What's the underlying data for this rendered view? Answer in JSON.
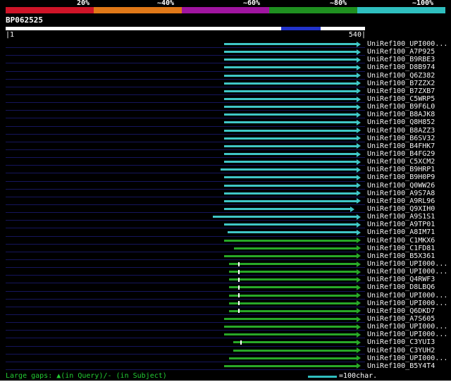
{
  "query": {
    "name": "BP062525",
    "bar_color": "#ffffff",
    "highlight": {
      "from": 414,
      "to": 473,
      "color": "#2233cc"
    }
  },
  "ruler": {
    "left": "|1",
    "right": "540|"
  },
  "footer": {
    "gaps_note": "Large gaps: ▲(in Query)/- (in Subject)",
    "gaps_color": "#22cc33",
    "scale_legend": "=100char.",
    "scale_line_color": "#2fbfbf",
    "scale_text_color": "#ffffff"
  },
  "chart_data": {
    "type": "bar",
    "orientation": "horizontal",
    "title": "BP062525 BLAST hit graphical overview",
    "x_axis": {
      "min": 1,
      "max": 540,
      "tick_labels": [
        "1",
        "540"
      ]
    },
    "grid": "row-separator-lines",
    "legend_position": "top",
    "legend": [
      {
        "label": "20%",
        "color": "#cf1428"
      },
      {
        "label": "~40%",
        "color": "#e07818"
      },
      {
        "label": "~60%",
        "color": "#a015a0"
      },
      {
        "label": "~80%",
        "color": "#1f9020"
      },
      {
        "label": "~100%",
        "color": "#2fbfbf"
      }
    ],
    "identity_colors": {
      "~100%": "#3fc6c6",
      "~80%": "#28a828"
    },
    "hits": [
      {
        "label": "UniRef100_UPI000...",
        "start": 329,
        "end": 534,
        "identity": "~100%"
      },
      {
        "label": "UniRef100_A7P925",
        "start": 329,
        "end": 534,
        "identity": "~100%"
      },
      {
        "label": "UniRef100_B9RBE3",
        "start": 329,
        "end": 534,
        "identity": "~100%"
      },
      {
        "label": "UniRef100_D8B974",
        "start": 329,
        "end": 534,
        "identity": "~100%"
      },
      {
        "label": "UniRef100_Q6Z382",
        "start": 329,
        "end": 534,
        "identity": "~100%"
      },
      {
        "label": "UniRef100_B7ZZX2",
        "start": 329,
        "end": 534,
        "identity": "~100%"
      },
      {
        "label": "UniRef100_B7ZXB7",
        "start": 329,
        "end": 534,
        "identity": "~100%"
      },
      {
        "label": "UniRef100_C5WRP5",
        "start": 329,
        "end": 534,
        "identity": "~100%"
      },
      {
        "label": "UniRef100_B9F6L0",
        "start": 329,
        "end": 534,
        "identity": "~100%"
      },
      {
        "label": "UniRef100_B8AJK8",
        "start": 329,
        "end": 534,
        "identity": "~100%"
      },
      {
        "label": "UniRef100_Q8H852",
        "start": 329,
        "end": 534,
        "identity": "~100%"
      },
      {
        "label": "UniRef100_B8AZZ3",
        "start": 329,
        "end": 534,
        "identity": "~100%"
      },
      {
        "label": "UniRef100_B6SV32",
        "start": 329,
        "end": 534,
        "identity": "~100%"
      },
      {
        "label": "UniRef100_B4FHK7",
        "start": 329,
        "end": 534,
        "identity": "~100%"
      },
      {
        "label": "UniRef100_B4FG29",
        "start": 329,
        "end": 534,
        "identity": "~100%"
      },
      {
        "label": "UniRef100_C5XCM2",
        "start": 329,
        "end": 534,
        "identity": "~100%"
      },
      {
        "label": "UniRef100_B9HRP1",
        "start": 323,
        "end": 534,
        "identity": "~100%"
      },
      {
        "label": "UniRef100_B9H0P9",
        "start": 329,
        "end": 534,
        "identity": "~100%"
      },
      {
        "label": "UniRef100_Q0WW26",
        "start": 329,
        "end": 534,
        "identity": "~100%"
      },
      {
        "label": "UniRef100_A9S7A8",
        "start": 329,
        "end": 534,
        "identity": "~100%"
      },
      {
        "label": "UniRef100_A9RL96",
        "start": 329,
        "end": 534,
        "identity": "~100%"
      },
      {
        "label": "UniRef100_Q9XIH0",
        "start": 329,
        "end": 524,
        "identity": "~100%"
      },
      {
        "label": "UniRef100_A9S1S1",
        "start": 312,
        "end": 534,
        "identity": "~100%"
      },
      {
        "label": "UniRef100_A9TP01",
        "start": 329,
        "end": 534,
        "identity": "~100%"
      },
      {
        "label": "UniRef100_A8IM71",
        "start": 334,
        "end": 534,
        "identity": "~100%"
      },
      {
        "label": "UniRef100_C1MKX6",
        "start": 329,
        "end": 534,
        "identity": "~80%"
      },
      {
        "label": "UniRef100_C1FD81",
        "start": 343,
        "end": 534,
        "identity": "~80%"
      },
      {
        "label": "UniRef100_B5X361",
        "start": 329,
        "end": 534,
        "identity": "~80%"
      },
      {
        "label": "UniRef100_UPI000...",
        "start": 336,
        "end": 534,
        "identity": "~80%",
        "gap_mark": 350
      },
      {
        "label": "UniRef100_UPI000...",
        "start": 336,
        "end": 534,
        "identity": "~80%",
        "gap_mark": 350
      },
      {
        "label": "UniRef100_Q4RWF3",
        "start": 336,
        "end": 534,
        "identity": "~80%",
        "gap_mark": 350
      },
      {
        "label": "UniRef100_D8LBQ6",
        "start": 336,
        "end": 534,
        "identity": "~80%",
        "gap_mark": 350
      },
      {
        "label": "UniRef100_UPI000...",
        "start": 336,
        "end": 534,
        "identity": "~80%",
        "gap_mark": 350
      },
      {
        "label": "UniRef100_UPI000...",
        "start": 336,
        "end": 534,
        "identity": "~80%",
        "gap_mark": 350
      },
      {
        "label": "UniRef100_Q6DKD7",
        "start": 336,
        "end": 534,
        "identity": "~80%",
        "gap_mark": 350
      },
      {
        "label": "UniRef100_A7S605",
        "start": 329,
        "end": 534,
        "identity": "~80%"
      },
      {
        "label": "UniRef100_UPI000...",
        "start": 329,
        "end": 534,
        "identity": "~80%"
      },
      {
        "label": "UniRef100_UPI000...",
        "start": 329,
        "end": 534,
        "identity": "~80%"
      },
      {
        "label": "UniRef100_C3YUI3",
        "start": 342,
        "end": 534,
        "identity": "~80%",
        "gap_mark": 353
      },
      {
        "label": "UniRef100_C3YUH2",
        "start": 342,
        "end": 534,
        "identity": "~80%"
      },
      {
        "label": "UniRef100_UPI000...",
        "start": 336,
        "end": 534,
        "identity": "~80%"
      },
      {
        "label": "UniRef100_B5Y4T4",
        "start": 329,
        "end": 534,
        "identity": "~80%"
      }
    ]
  }
}
